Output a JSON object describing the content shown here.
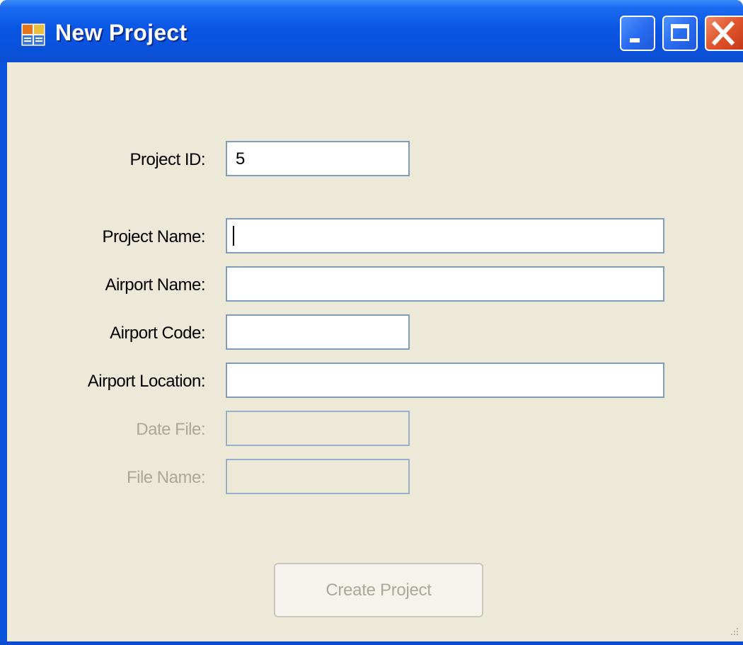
{
  "window": {
    "title": "New Project",
    "icon": "app-window-icon"
  },
  "titlebar_buttons": {
    "minimize": "minimize-icon",
    "maximize": "maximize-icon",
    "close": "close-icon"
  },
  "form": {
    "project_id": {
      "label": "Project ID:",
      "value": "5"
    },
    "project_name": {
      "label": "Project Name:",
      "value": ""
    },
    "airport_name": {
      "label": "Airport Name:",
      "value": ""
    },
    "airport_code": {
      "label": "Airport Code:",
      "value": ""
    },
    "airport_location": {
      "label": "Airport Location:",
      "value": ""
    },
    "date_file": {
      "label": "Date File:",
      "value": "",
      "enabled": false
    },
    "file_name": {
      "label": "File Name:",
      "value": "",
      "enabled": false
    }
  },
  "actions": {
    "create_label": "Create Project",
    "create_enabled": false
  },
  "colors": {
    "titlebar": "#0a56e4",
    "client_background": "#ece9d8",
    "field_border": "#7f9db9",
    "disabled_text": "#aca899",
    "close_button": "#e0552c"
  }
}
